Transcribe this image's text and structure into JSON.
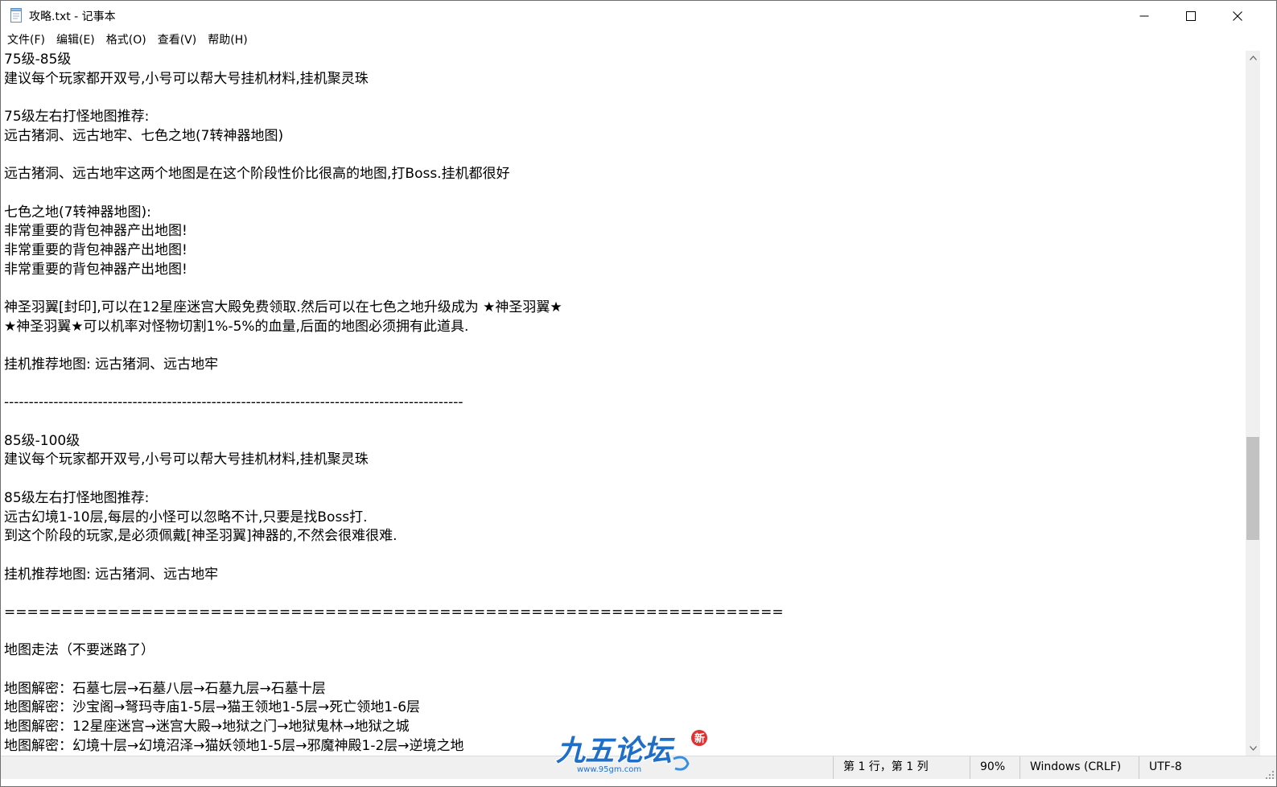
{
  "window": {
    "title": "攻略.txt - 记事本",
    "icon": "notepad-icon"
  },
  "menu": [
    "文件(F)",
    "编辑(E)",
    "格式(O)",
    "查看(V)",
    "帮助(H)"
  ],
  "document": {
    "lines": [
      "75级-85级",
      "建议每个玩家都开双号,小号可以帮大号挂机材料,挂机聚灵珠",
      "",
      "75级左右打怪地图推荐:",
      "远古猪洞、远古地牢、七色之地(7转神器地图)",
      "",
      "远古猪洞、远古地牢这两个地图是在这个阶段性价比很高的地图,打Boss.挂机都很好",
      "",
      "七色之地(7转神器地图):",
      "非常重要的背包神器产出地图!",
      "非常重要的背包神器产出地图!",
      "非常重要的背包神器产出地图!",
      "",
      "神圣羽翼[封印],可以在12星座迷宫大殿免费领取.然后可以在七色之地升级成为 ★神圣羽翼★",
      "★神圣羽翼★可以机率对怪物切割1%-5%的血量,后面的地图必须拥有此道具.",
      "",
      "挂机推荐地图: 远古猪洞、远古地牢",
      "",
      "---------------------------------------------------------------------------------------------",
      "",
      "85级-100级",
      "建议每个玩家都开双号,小号可以帮大号挂机材料,挂机聚灵珠",
      "",
      "85级左右打怪地图推荐:",
      "远古幻境1-10层,每层的小怪可以忽略不计,只要是找Boss打.",
      "到这个阶段的玩家,是必须佩戴[神圣羽翼]神器的,不然会很难很难.",
      "",
      "挂机推荐地图: 远古猪洞、远古地牢",
      "",
      "====================================================================",
      "",
      "地图走法（不要迷路了）",
      "",
      "地图解密：石墓七层→石墓八层→石墓九层→石墓十层",
      "地图解密：沙宝阁→弩玛寺庙1-5层→猫王领地1-5层→死亡领地1-6层",
      "地图解密：12星座迷宫→迷宫大殿→地狱之门→地狱鬼林→地狱之城",
      "地图解密：幻境十层→幻境沼泽→猫妖领地1-5层→邪魔神殿1-2层→逆境之地"
    ]
  },
  "status": {
    "position": "第 1 行，第 1 列",
    "zoom": "90%",
    "line_ending": "Windows (CRLF)",
    "encoding": "UTF-8"
  },
  "watermark": {
    "text": "九五论坛",
    "url": "www.95gm.com",
    "badge": "新"
  }
}
